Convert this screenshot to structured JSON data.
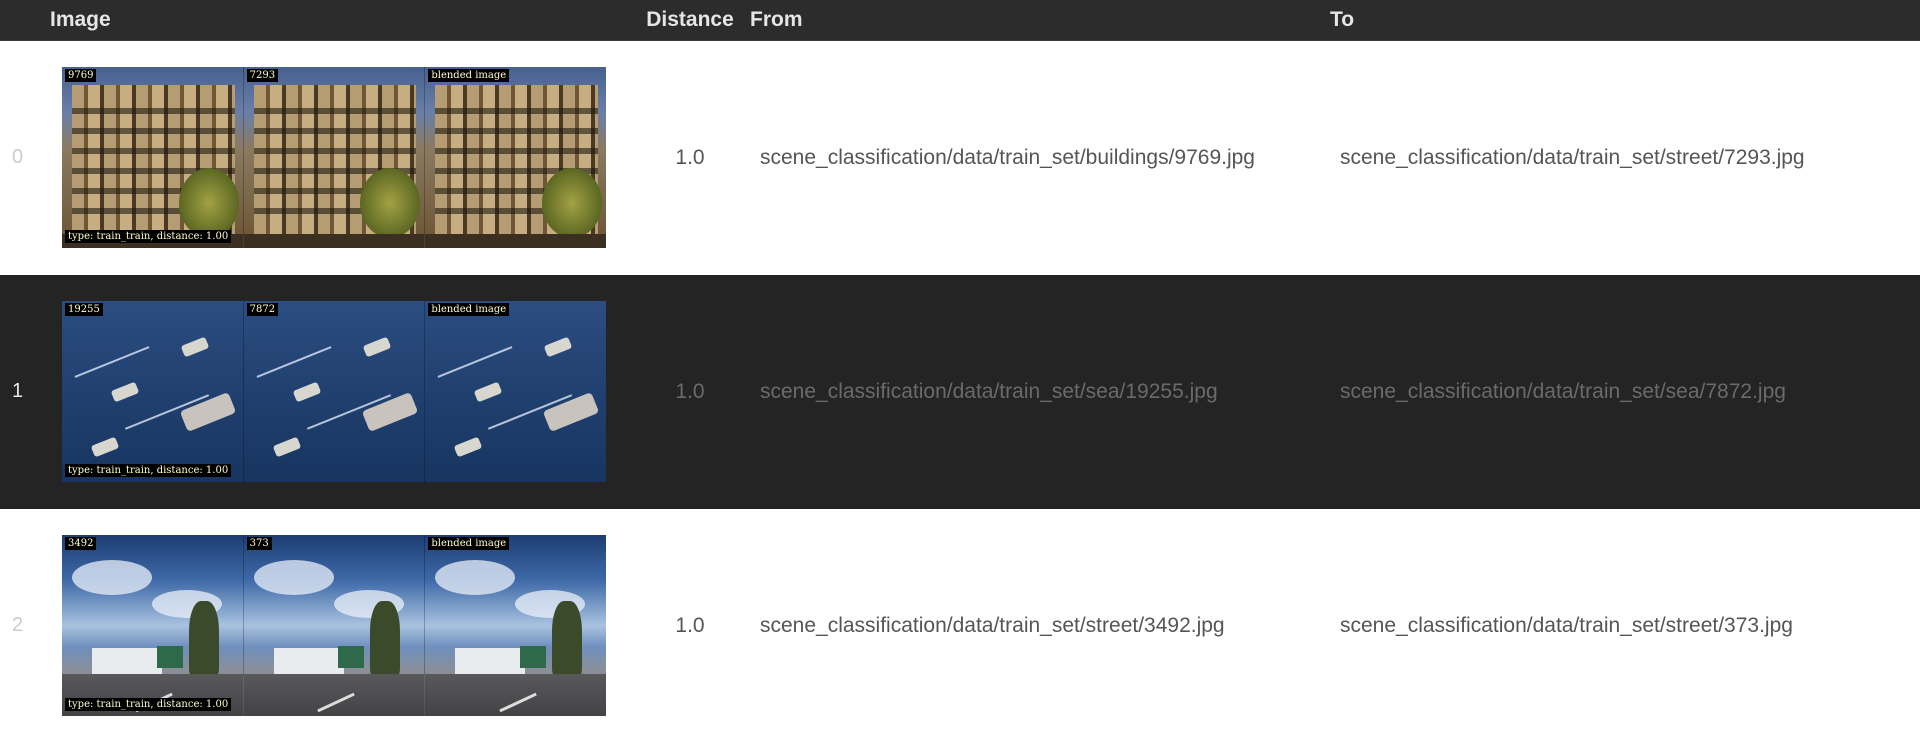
{
  "header": {
    "image": "Image",
    "distance": "Distance",
    "from": "From",
    "to": "To"
  },
  "rows": [
    {
      "index": "0",
      "distance": "1.0",
      "from": "scene_classification/data/train_set/buildings/9769.jpg",
      "to": "scene_classification/data/train_set/street/7293.jpg",
      "tags": [
        "9769",
        "7293",
        "blended image"
      ],
      "caption": "type: train_train, distance: 1.00"
    },
    {
      "index": "1",
      "distance": "1.0",
      "from": "scene_classification/data/train_set/sea/19255.jpg",
      "to": "scene_classification/data/train_set/sea/7872.jpg",
      "tags": [
        "19255",
        "7872",
        "blended image"
      ],
      "caption": "type: train_train, distance: 1.00"
    },
    {
      "index": "2",
      "distance": "1.0",
      "from": "scene_classification/data/train_set/street/3492.jpg",
      "to": "scene_classification/data/train_set/street/373.jpg",
      "tags": [
        "3492",
        "373",
        "blended image"
      ],
      "caption": "type: train_train, distance: 1.00"
    }
  ],
  "colors": {
    "header_bg": "#2c2c2c",
    "odd_row_bg": "#242424",
    "tag_text": "#ffffcc"
  }
}
